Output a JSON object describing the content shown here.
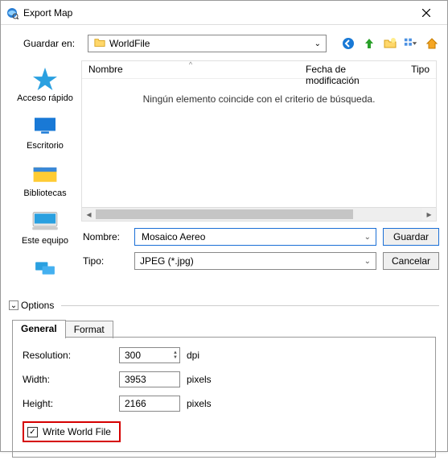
{
  "title": "Export Map",
  "source": {
    "label": "Guardar en:",
    "folder": "WorldFile"
  },
  "filelist": {
    "col_name": "Nombre",
    "col_modified": "Fecha de modificación",
    "col_type": "Tipo",
    "empty": "Ningún elemento coincide con el criterio de búsqueda."
  },
  "nav": {
    "quick": "Acceso rápido",
    "desktop": "Escritorio",
    "libraries": "Bibliotecas",
    "thispc": "Este equipo"
  },
  "form": {
    "name_label": "Nombre:",
    "name_value": "Mosaico Aereo",
    "type_label": "Tipo:",
    "type_value": "JPEG (*.jpg)",
    "save": "Guardar",
    "cancel": "Cancelar"
  },
  "options": {
    "label": "Options",
    "tab_general": "General",
    "tab_format": "Format",
    "resolution_label": "Resolution:",
    "resolution_value": "300",
    "resolution_unit": "dpi",
    "width_label": "Width:",
    "width_value": "3953",
    "height_label": "Height:",
    "height_value": "2166",
    "pixels": "pixels",
    "wwf": "Write World File"
  }
}
